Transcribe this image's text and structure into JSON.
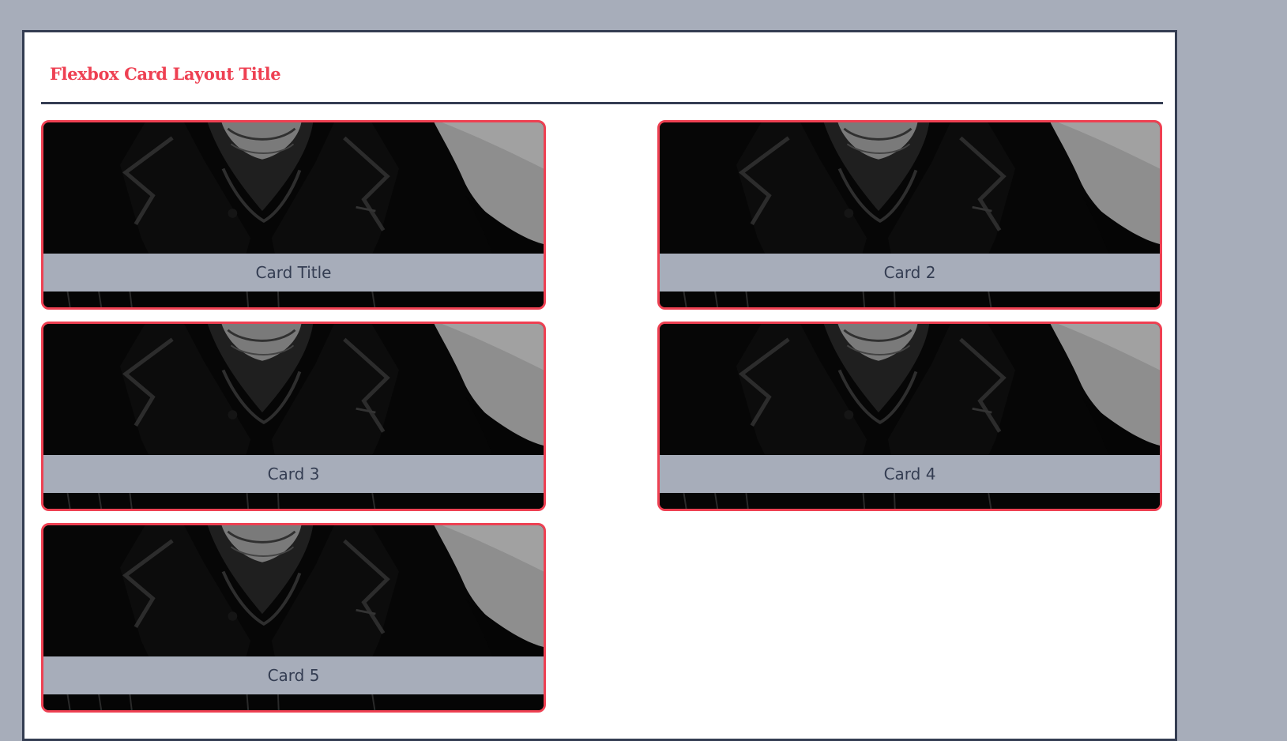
{
  "page": {
    "title": "Flexbox Card Layout Title"
  },
  "theme": {
    "background": "#a7adba",
    "accent": "#ee4052",
    "dark": "#343d52",
    "caption_bg": "#a7adba"
  },
  "cards": [
    {
      "title": "Card Title",
      "image_icon": "portrait-photo"
    },
    {
      "title": "Card 2",
      "image_icon": "portrait-photo"
    },
    {
      "title": "Card 3",
      "image_icon": "portrait-photo"
    },
    {
      "title": "Card 4",
      "image_icon": "portrait-photo"
    },
    {
      "title": "Card 5",
      "image_icon": "portrait-photo"
    }
  ]
}
